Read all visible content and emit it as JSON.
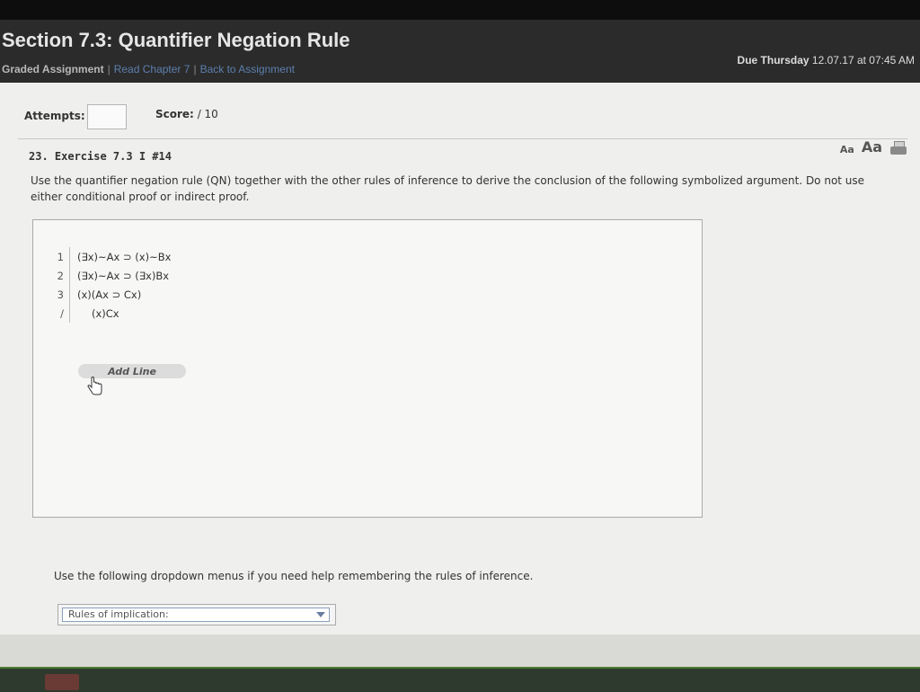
{
  "header": {
    "title": "Section 7.3: Quantifier Negation Rule",
    "breadcrumb": {
      "graded": "Graded Assignment",
      "read_chapter": "Read Chapter 7",
      "back": "Back to Assignment",
      "separator": "|"
    },
    "due": {
      "label": "Due Thursday",
      "datetime": "12.07.17 at 07:45 AM"
    }
  },
  "meta": {
    "attempts_label": "Attempts:",
    "attempts_value": "",
    "score_label": "Score:",
    "score_value": "/ 10"
  },
  "exercise": {
    "title": "23. Exercise 7.3 I #14",
    "font_small": "Aa",
    "font_large": "Aa",
    "instructions": "Use the quantifier negation rule (QN) together with the other rules of inference to derive the conclusion of the following symbolized argument. Do not use either conditional proof or indirect proof."
  },
  "proof": {
    "lines": [
      {
        "num": "1",
        "formula": "(∃x)~Ax ⊃ (x)~Bx"
      },
      {
        "num": "2",
        "formula": "(∃x)~Ax ⊃ (∃x)Bx"
      },
      {
        "num": "3",
        "formula": "(x)(Ax ⊃ Cx)"
      }
    ],
    "conclusion": {
      "num": "/",
      "formula": "(x)Cx"
    },
    "add_line_label": "Add Line"
  },
  "help": {
    "dropdown_text": "Use the following dropdown menus if you need help remembering the rules of inference.",
    "rules_select_value": "Rules of implication:"
  },
  "colors": {
    "link": "#5c7fae",
    "header_bg": "#2b2b2b",
    "content_bg": "#efefed"
  }
}
